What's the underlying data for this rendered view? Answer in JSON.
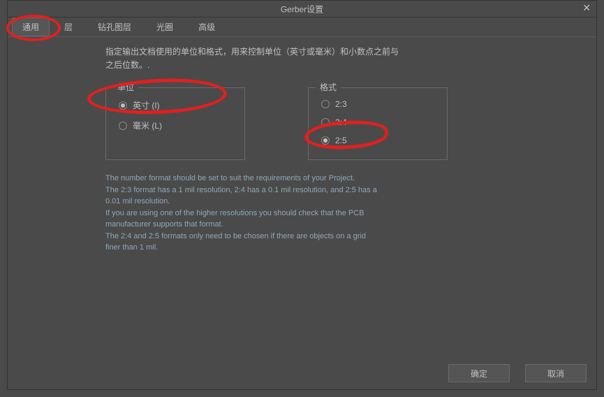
{
  "window": {
    "title": "Gerber设置"
  },
  "tabs": {
    "items": [
      {
        "label": "通用",
        "active": true
      },
      {
        "label": "层",
        "active": false
      },
      {
        "label": "钻孔图层",
        "active": false
      },
      {
        "label": "光圈",
        "active": false
      },
      {
        "label": "高级",
        "active": false
      }
    ]
  },
  "description_line1": "指定输出文档使用的单位和格式，用来控制单位（英寸或毫米）和小数点之前与",
  "description_line2": "之后位数。.",
  "groups": {
    "units": {
      "label": "单位",
      "options": [
        {
          "label": "英寸 (I)",
          "checked": true
        },
        {
          "label": "毫米 (L)",
          "checked": false
        }
      ]
    },
    "format": {
      "label": "格式",
      "options": [
        {
          "label": "2:3",
          "checked": false
        },
        {
          "label": "2:4",
          "checked": false
        },
        {
          "label": "2:5",
          "checked": true
        }
      ]
    }
  },
  "help": {
    "l1": "The number format should be set to suit the requirements of your Project.",
    "l2": "The 2:3 format has a 1 mil resolution, 2:4 has a 0.1 mil resolution, and 2:5 has a",
    "l3": "0.01 mil resolution.",
    "l4": "If you are using one of the higher resolutions you should check that the PCB",
    "l5": "manufacturer supports that format.",
    "l6": "The 2:4 and 2:5 formats only need to be chosen if there are objects on a grid",
    "l7": "finer than 1 mil."
  },
  "footer": {
    "ok": "确定",
    "cancel": "取消"
  },
  "annotation_color": "#e02020"
}
